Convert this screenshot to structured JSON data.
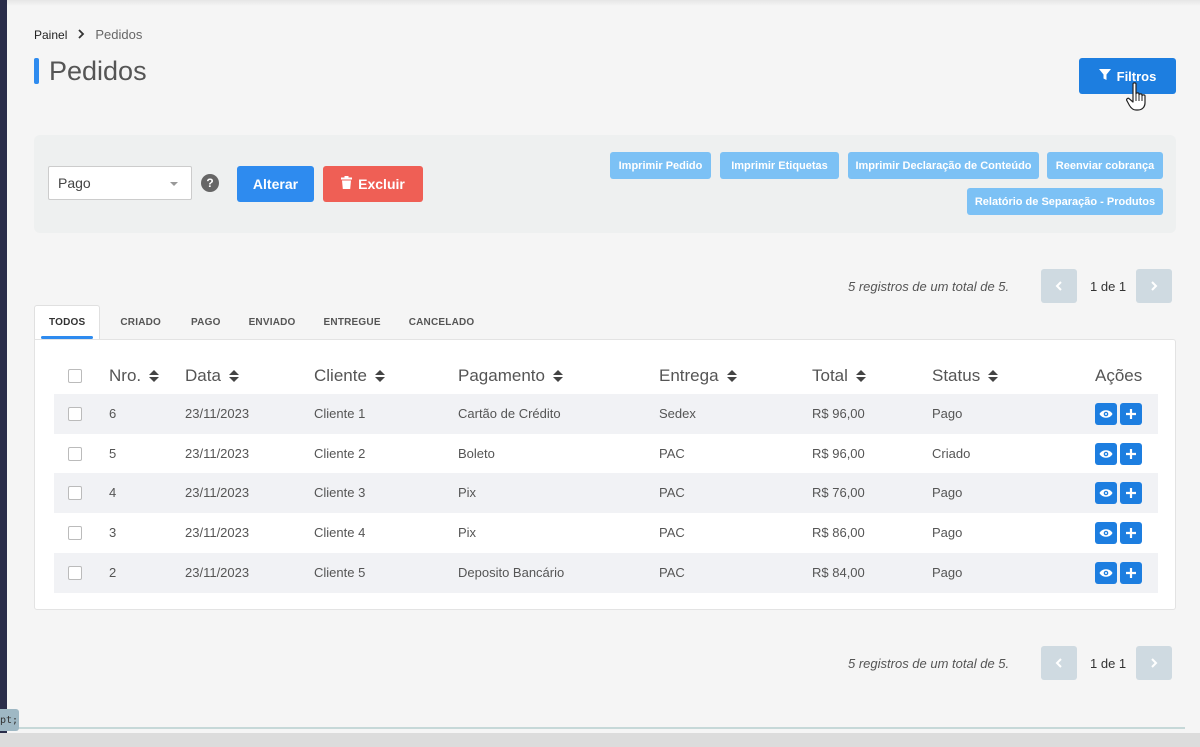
{
  "breadcrumb": {
    "home": "Painel",
    "current": "Pedidos"
  },
  "page": {
    "title": "Pedidos"
  },
  "header": {
    "filters_label": "Filtros"
  },
  "actions": {
    "status_select": "Pago",
    "help": "?",
    "alter_label": "Alterar",
    "delete_label": "Excluir",
    "print_order": "Imprimir Pedido",
    "print_labels": "Imprimir Etiquetas",
    "print_declaration": "Imprimir Declaração de Conteúdo",
    "resend_charge": "Reenviar cobrança",
    "separation_report": "Relatório de Separação - Produtos"
  },
  "pagination": {
    "summary": "5 registros de um total de 5.",
    "page_info": "1 de 1"
  },
  "tabs": [
    "TODOS",
    "CRIADO",
    "PAGO",
    "ENVIADO",
    "ENTREGUE",
    "CANCELADO"
  ],
  "table": {
    "columns": [
      "Nro.",
      "Data",
      "Cliente",
      "Pagamento",
      "Entrega",
      "Total",
      "Status",
      "Ações"
    ],
    "rows": [
      {
        "nro": "6",
        "data": "23/11/2023",
        "cliente": "Cliente 1",
        "pagamento": "Cartão de Crédito",
        "entrega": "Sedex",
        "total": "R$ 96,00",
        "status": "Pago"
      },
      {
        "nro": "5",
        "data": "23/11/2023",
        "cliente": "Cliente 2",
        "pagamento": "Boleto",
        "entrega": "PAC",
        "total": "R$ 96,00",
        "status": "Criado"
      },
      {
        "nro": "4",
        "data": "23/11/2023",
        "cliente": "Cliente 3",
        "pagamento": "Pix",
        "entrega": "PAC",
        "total": "R$ 76,00",
        "status": "Pago"
      },
      {
        "nro": "3",
        "data": "23/11/2023",
        "cliente": "Cliente 4",
        "pagamento": "Pix",
        "entrega": "PAC",
        "total": "R$ 86,00",
        "status": "Pago"
      },
      {
        "nro": "2",
        "data": "23/11/2023",
        "cliente": "Cliente 5",
        "pagamento": "Deposito Bancário",
        "entrega": "PAC",
        "total": "R$ 84,00",
        "status": "Pago"
      }
    ]
  },
  "misc": {
    "corner_tag": "pt;"
  },
  "colors": {
    "primary": "#1d7ee0",
    "accent": "#2e8bef",
    "danger": "#ef5f55",
    "light_button": "#7cc1f5"
  },
  "icons": [
    "chevron-right-icon",
    "filter-icon",
    "hand-cursor-icon",
    "help-icon",
    "trash-icon",
    "chevron-left-icon",
    "eye-icon",
    "plus-icon",
    "sort-icon"
  ]
}
